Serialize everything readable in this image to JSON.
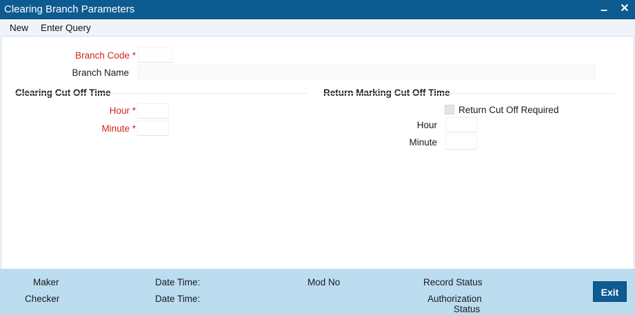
{
  "window": {
    "title": "Clearing Branch Parameters"
  },
  "menu": {
    "new_label": "New",
    "enter_query_label": "Enter Query"
  },
  "form": {
    "branch_code_label": "Branch Code",
    "branch_code_value": "",
    "branch_name_label": "Branch Name",
    "branch_name_value": "",
    "required_marker": "*"
  },
  "clearing_cutoff": {
    "title": "Clearing Cut Off Time",
    "hour_label": "Hour",
    "hour_value": "",
    "minute_label": "Minute",
    "minute_value": ""
  },
  "return_cutoff": {
    "title": "Return Marking Cut Off Time",
    "required_label": "Return Cut Off Required",
    "required_checked": false,
    "hour_label": "Hour",
    "hour_value": "",
    "minute_label": "Minute",
    "minute_value": ""
  },
  "footer": {
    "maker_label": "Maker",
    "checker_label": "Checker",
    "date_time_label_1": "Date Time:",
    "date_time_label_2": "Date Time:",
    "mod_no_label": "Mod No",
    "record_status_label": "Record Status",
    "authorization_status_label_line1": "Authorization",
    "authorization_status_label_line2": "Status",
    "exit_label": "Exit"
  },
  "colors": {
    "title_bar": "#0d5b91",
    "required_label": "#d1241b",
    "footer_background": "#bcdcef",
    "exit_button": "#0d5b91"
  }
}
